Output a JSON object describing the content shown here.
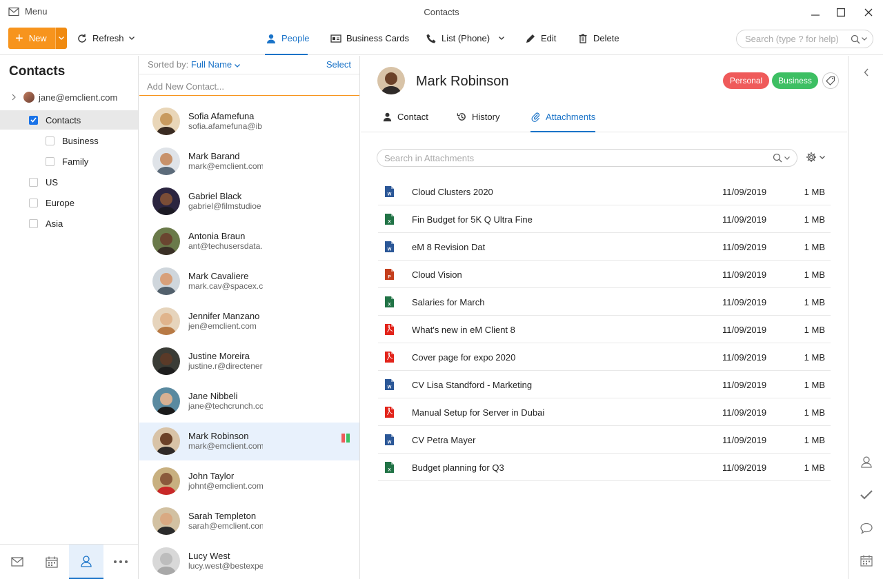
{
  "window": {
    "menu_label": "Menu",
    "title": "Contacts"
  },
  "toolbar": {
    "new_label": "New",
    "refresh_label": "Refresh",
    "people_label": "People",
    "business_cards_label": "Business Cards",
    "list_phone_label": "List (Phone)",
    "edit_label": "Edit",
    "delete_label": "Delete",
    "search_placeholder": "Search (type ? for help)"
  },
  "sidebar": {
    "title": "Contacts",
    "account": "jane@emclient.com",
    "folders": [
      {
        "label": "Contacts",
        "checked": true,
        "selected": true
      },
      {
        "label": "Business",
        "checked": false
      },
      {
        "label": "Family",
        "checked": false
      },
      {
        "label": "US",
        "checked": false
      },
      {
        "label": "Europe",
        "checked": false
      },
      {
        "label": "Asia",
        "checked": false
      }
    ],
    "bottom_icons": [
      "mail-icon",
      "calendar-icon",
      "contacts-icon",
      "more-icon"
    ]
  },
  "contact_list": {
    "sorted_by_label": "Sorted by:",
    "sorted_by_value": "Full Name",
    "select_label": "Select",
    "add_placeholder": "Add New Contact...",
    "contacts": [
      {
        "name": "Sofia Afamefuna",
        "email": "sofia.afamefuna@ib"
      },
      {
        "name": "Mark Barand",
        "email": "mark@emclient.com"
      },
      {
        "name": "Gabriel Black",
        "email": "gabriel@filmstudioe"
      },
      {
        "name": "Antonia Braun",
        "email": "ant@techusersdata.c"
      },
      {
        "name": "Mark Cavaliere",
        "email": "mark.cav@spacex.co"
      },
      {
        "name": "Jennifer Manzano",
        "email": "jen@emclient.com"
      },
      {
        "name": "Justine Moreira",
        "email": "justine.r@directener"
      },
      {
        "name": "Jane Nibbeli",
        "email": "jane@techcrunch.co"
      },
      {
        "name": "Mark Robinson",
        "email": "mark@emclient.com"
      },
      {
        "name": "John Taylor",
        "email": "johnt@emclient.com"
      },
      {
        "name": "Sarah Templeton",
        "email": "sarah@emclient.con"
      },
      {
        "name": "Lucy West",
        "email": "lucy.west@bestexpe"
      }
    ]
  },
  "detail": {
    "name": "Mark Robinson",
    "tags": [
      "Personal",
      "Business"
    ],
    "tabs": [
      "Contact",
      "History",
      "Attachments"
    ],
    "search_placeholder": "Search in Attachments",
    "attachments": [
      {
        "name": "Cloud Clusters 2020",
        "date": "11/09/2019",
        "size": "1 MB",
        "type": "word"
      },
      {
        "name": "Fin Budget for 5K Q Ultra Fine",
        "date": "11/09/2019",
        "size": "1 MB",
        "type": "excel"
      },
      {
        "name": "eM 8 Revision Dat",
        "date": "11/09/2019",
        "size": "1 MB",
        "type": "word"
      },
      {
        "name": "Cloud Vision",
        "date": "11/09/2019",
        "size": "1 MB",
        "type": "powerpoint"
      },
      {
        "name": "Salaries for March",
        "date": "11/09/2019",
        "size": "1 MB",
        "type": "excel"
      },
      {
        "name": "What's new in eM Client 8",
        "date": "11/09/2019",
        "size": "1 MB",
        "type": "pdf"
      },
      {
        "name": "Cover page for expo 2020",
        "date": "11/09/2019",
        "size": "1 MB",
        "type": "pdf"
      },
      {
        "name": "CV Lisa Standford - Marketing",
        "date": "11/09/2019",
        "size": "1 MB",
        "type": "word"
      },
      {
        "name": "Manual Setup for Server in Dubai",
        "date": "11/09/2019",
        "size": "1 MB",
        "type": "pdf"
      },
      {
        "name": "CV Petra Mayer",
        "date": "11/09/2019",
        "size": "1 MB",
        "type": "word"
      },
      {
        "name": "Budget planning for Q3",
        "date": "11/09/2019",
        "size": "1 MB",
        "type": "excel"
      }
    ]
  },
  "colors": {
    "accent": "#1a73c8",
    "new_button": "#f7941d",
    "tag_personal": "#ef5a5a",
    "tag_business": "#3dbf63",
    "word": "#2b5797",
    "excel": "#217346",
    "powerpoint": "#c43e1c",
    "pdf": "#e2231a"
  },
  "right_rail_icons": [
    "collapse-arrow-icon",
    "contact-icon",
    "checkmark-icon",
    "chat-icon",
    "calendar-icon"
  ]
}
